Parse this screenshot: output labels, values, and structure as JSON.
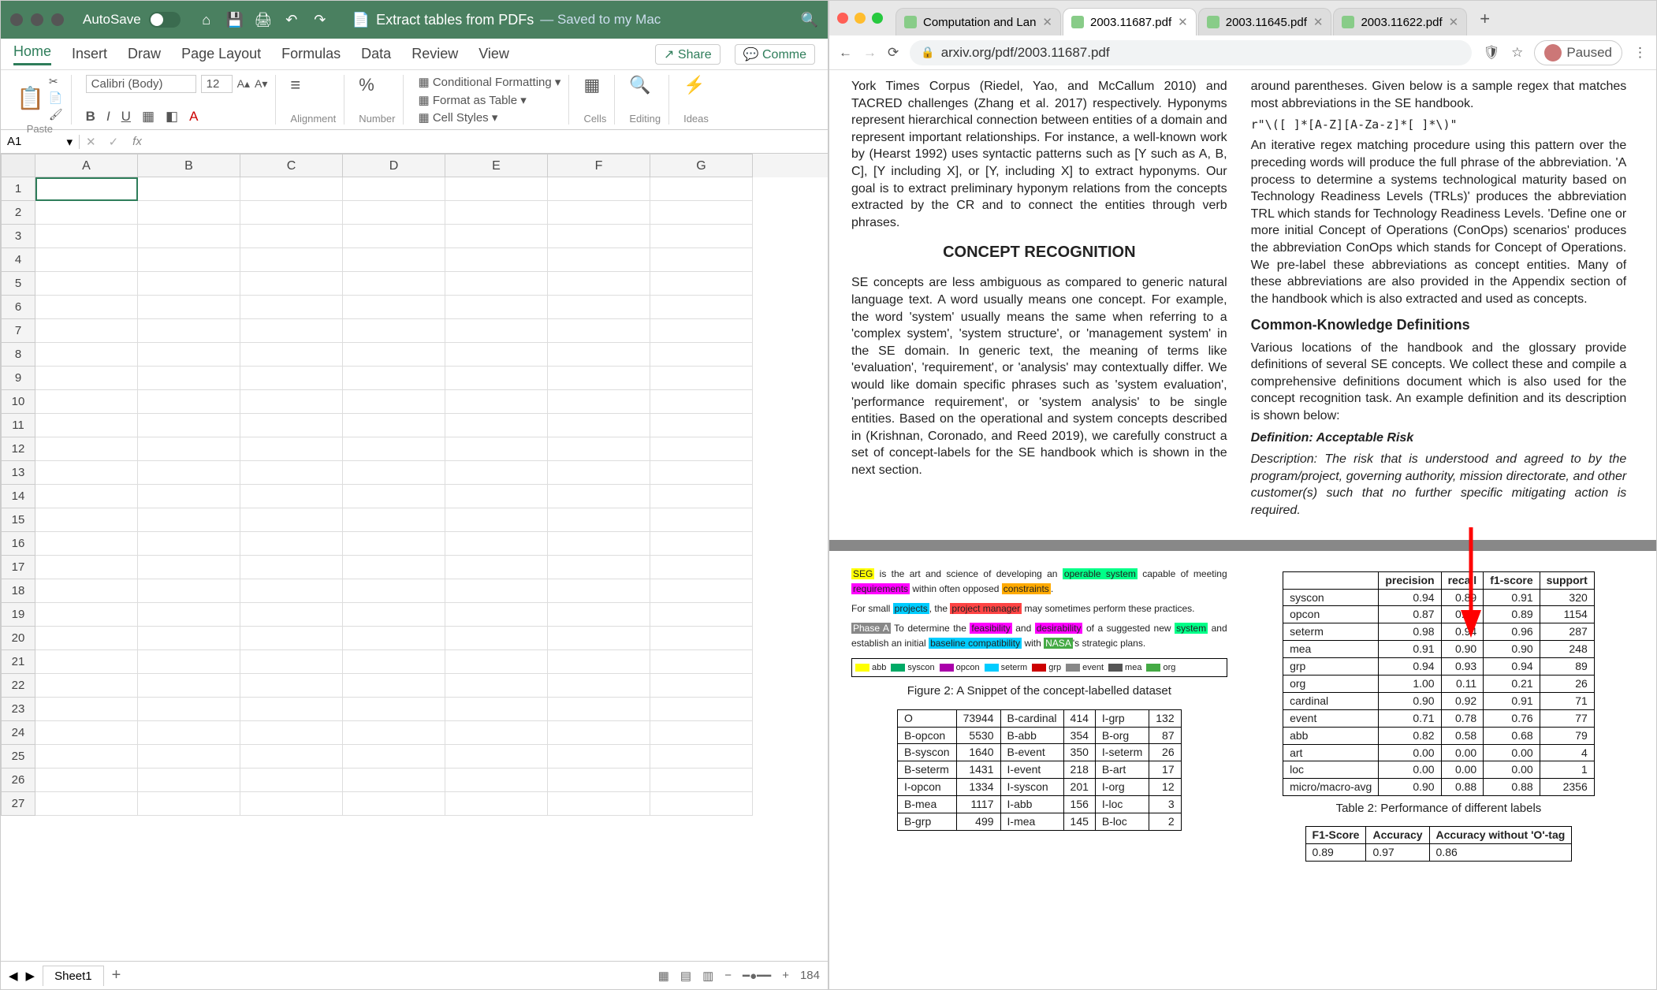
{
  "excel": {
    "autosave_label": "AutoSave",
    "autosave_state": "OFF",
    "doc_title": "Extract tables from PDFs",
    "saved_status": "— Saved to my Mac",
    "tabs": [
      "Home",
      "Insert",
      "Draw",
      "Page Layout",
      "Formulas",
      "Data",
      "Review",
      "View"
    ],
    "active_tab": "Home",
    "share": "Share",
    "comments": "Comme",
    "paste": "Paste",
    "font_name": "Calibri (Body)",
    "font_size": "12",
    "group_alignment": "Alignment",
    "group_number": "Number",
    "cond_fmt": "Conditional Formatting",
    "fmt_table": "Format as Table",
    "cell_styles": "Cell Styles",
    "cells": "Cells",
    "editing": "Editing",
    "ideas": "Ideas",
    "namebox": "A1",
    "columns": [
      "A",
      "B",
      "C",
      "D",
      "E",
      "F",
      "G"
    ],
    "row_count": 27,
    "sheet_name": "Sheet1",
    "zoom": "184"
  },
  "chrome": {
    "tabs": [
      {
        "title": "Computation and Lan",
        "active": false
      },
      {
        "title": "2003.11687.pdf",
        "active": true
      },
      {
        "title": "2003.11645.pdf",
        "active": false
      },
      {
        "title": "2003.11622.pdf",
        "active": false
      }
    ],
    "url": "arxiv.org/pdf/2003.11687.pdf",
    "paused": "Paused"
  },
  "pdf": {
    "left_top": "York Times Corpus (Riedel, Yao, and McCallum 2010) and TACRED challenges (Zhang et al. 2017) respectively. Hyponyms represent hierarchical connection between entities of a domain and represent important relationships. For instance, a well-known work by (Hearst 1992) uses syntactic patterns such as [Y such as A, B, C], [Y including X], or [Y, including X] to extract hyponyms. Our goal is to extract preliminary hyponym relations from the concepts extracted by the CR and to connect the entities through verb phrases.",
    "section_cr": "CONCEPT RECOGNITION",
    "left_cr": "SE concepts are less ambiguous as compared to generic natural language text. A word usually means one concept. For example, the word 'system' usually means the same when referring to a 'complex system', 'system structure', or 'management system' in the SE domain. In generic text, the meaning of terms like 'evaluation', 'requirement', or 'analysis' may contextually differ. We would like domain specific phrases such as 'system evaluation', 'performance requirement', or 'system analysis' to be single entities. Based on the operational and system concepts described in (Krishnan, Coronado, and Reed 2019), we carefully construct a set of concept-labels for the SE handbook which is shown in the next section.",
    "right_top": "around parentheses. Given below is a sample regex that matches most abbreviations in the SE handbook.",
    "regex": "r\"\\([ ]*[A-Z][A-Za-z]*[ ]*\\)\"",
    "right_mid": "An iterative regex matching procedure using this pattern over the preceding words will produce the full phrase of the abbreviation. 'A process to determine a systems technological maturity based on Technology Readiness Levels (TRLs)' produces the abbreviation TRL which stands for Technology Readiness Levels. 'Define one or more initial Concept of Operations (ConOps) scenarios' produces the abbreviation ConOps which stands for Concept of Operations. We pre-label these abbreviations as concept entities. Many of these abbreviations are also provided in the Appendix section of the handbook which is also extracted and used as concepts.",
    "ckd_head": "Common-Knowledge Definitions",
    "ckd": "Various locations of the handbook and the glossary provide definitions of several SE concepts. We collect these and compile a comprehensive definitions document which is also used for the concept recognition task. An example definition and its description is shown below:",
    "def1": "Definition: Acceptable Risk",
    "def2": "Description: The risk that is understood and agreed to by the program/project, governing authority, mission directorate, and other customer(s) such that no further specific mitigating action is required.",
    "fig2_caption": "Figure 2: A Snippet of the concept-labelled dataset",
    "snippet_lines": [
      "SEG is the art and science of developing an operable system capable of meeting requirements within often opposed constraints.",
      "For small projects, the project manager may sometimes perform these practices.",
      "Phase A To determine the feasibility and desirability of a suggested new system and establish an initial baseline compatibility with NASA's strategic plans."
    ],
    "legend": [
      "abb",
      "syscon",
      "opcon",
      "seterm",
      "grp",
      "event",
      "mea",
      "org"
    ],
    "freq_table": {
      "rows": [
        [
          "O",
          "73944",
          "B-cardinal",
          "414",
          "I-grp",
          "132"
        ],
        [
          "B-opcon",
          "5530",
          "B-abb",
          "354",
          "B-org",
          "87"
        ],
        [
          "B-syscon",
          "1640",
          "B-event",
          "350",
          "I-seterm",
          "26"
        ],
        [
          "B-seterm",
          "1431",
          "I-event",
          "218",
          "B-art",
          "17"
        ],
        [
          "I-opcon",
          "1334",
          "I-syscon",
          "201",
          "I-org",
          "12"
        ],
        [
          "B-mea",
          "1117",
          "I-abb",
          "156",
          "I-loc",
          "3"
        ],
        [
          "B-grp",
          "499",
          "I-mea",
          "145",
          "B-loc",
          "2"
        ]
      ]
    },
    "perf_table": {
      "headers": [
        "",
        "precision",
        "recall",
        "f1-score",
        "support"
      ],
      "rows": [
        [
          "syscon",
          "0.94",
          "0.89",
          "0.91",
          "320"
        ],
        [
          "opcon",
          "0.87",
          "0.91",
          "0.89",
          "1154"
        ],
        [
          "seterm",
          "0.98",
          "0.94",
          "0.96",
          "287"
        ],
        [
          "mea",
          "0.91",
          "0.90",
          "0.90",
          "248"
        ],
        [
          "grp",
          "0.94",
          "0.93",
          "0.94",
          "89"
        ],
        [
          "org",
          "1.00",
          "0.11",
          "0.21",
          "26"
        ],
        [
          "cardinal",
          "0.90",
          "0.92",
          "0.91",
          "71"
        ],
        [
          "event",
          "0.71",
          "0.78",
          "0.76",
          "77"
        ],
        [
          "abb",
          "0.82",
          "0.58",
          "0.68",
          "79"
        ],
        [
          "art",
          "0.00",
          "0.00",
          "0.00",
          "4"
        ],
        [
          "loc",
          "0.00",
          "0.00",
          "0.00",
          "1"
        ],
        [
          "micro/macro-avg",
          "0.90",
          "0.88",
          "0.88",
          "2356"
        ]
      ]
    },
    "table2_caption": "Table 2: Performance of different labels",
    "acc_table": {
      "headers": [
        "F1-Score",
        "Accuracy",
        "Accuracy without 'O'-tag"
      ],
      "row": [
        "0.89",
        "0.97",
        "0.86"
      ]
    }
  },
  "chart_data": {
    "type": "table",
    "title": "Table 2: Performance of different labels",
    "columns": [
      "label",
      "precision",
      "recall",
      "f1-score",
      "support"
    ],
    "rows": [
      [
        "syscon",
        0.94,
        0.89,
        0.91,
        320
      ],
      [
        "opcon",
        0.87,
        0.91,
        0.89,
        1154
      ],
      [
        "seterm",
        0.98,
        0.94,
        0.96,
        287
      ],
      [
        "mea",
        0.91,
        0.9,
        0.9,
        248
      ],
      [
        "grp",
        0.94,
        0.93,
        0.94,
        89
      ],
      [
        "org",
        1.0,
        0.11,
        0.21,
        26
      ],
      [
        "cardinal",
        0.9,
        0.92,
        0.91,
        71
      ],
      [
        "event",
        0.71,
        0.78,
        0.76,
        77
      ],
      [
        "abb",
        0.82,
        0.58,
        0.68,
        79
      ],
      [
        "art",
        0.0,
        0.0,
        0.0,
        4
      ],
      [
        "loc",
        0.0,
        0.0,
        0.0,
        1
      ],
      [
        "micro/macro-avg",
        0.9,
        0.88,
        0.88,
        2356
      ]
    ]
  }
}
